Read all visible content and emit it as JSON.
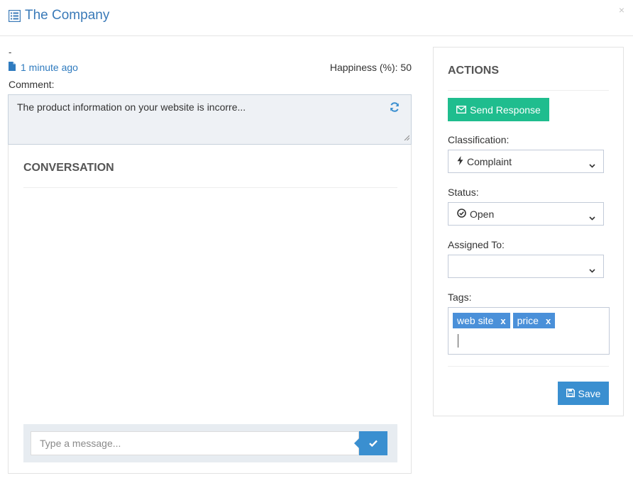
{
  "header": {
    "title": "The Company",
    "close_label": "×"
  },
  "meta": {
    "dash": "-",
    "time_ago": "1 minute ago",
    "happiness": "Happiness (%): 50",
    "comment_label": "Comment:"
  },
  "comment": {
    "text": "The product information on your website is incorre..."
  },
  "conversation": {
    "title": "CONVERSATION",
    "message_placeholder": "Type a message..."
  },
  "actions": {
    "title": "ACTIONS",
    "send_response_label": "Send Response",
    "classification_label": "Classification:",
    "classification_value": "Complaint",
    "status_label": "Status:",
    "status_value": "Open",
    "assigned_label": "Assigned To:",
    "assigned_value": "",
    "tags_label": "Tags:",
    "tags": [
      {
        "label": "web site",
        "remove": "x"
      },
      {
        "label": "price",
        "remove": "x"
      }
    ],
    "save_label": "Save"
  },
  "colors": {
    "link": "#2f7bbf",
    "send_response": "#1fbd8e",
    "primary": "#3a8fd0",
    "tag": "#4a90d9"
  }
}
